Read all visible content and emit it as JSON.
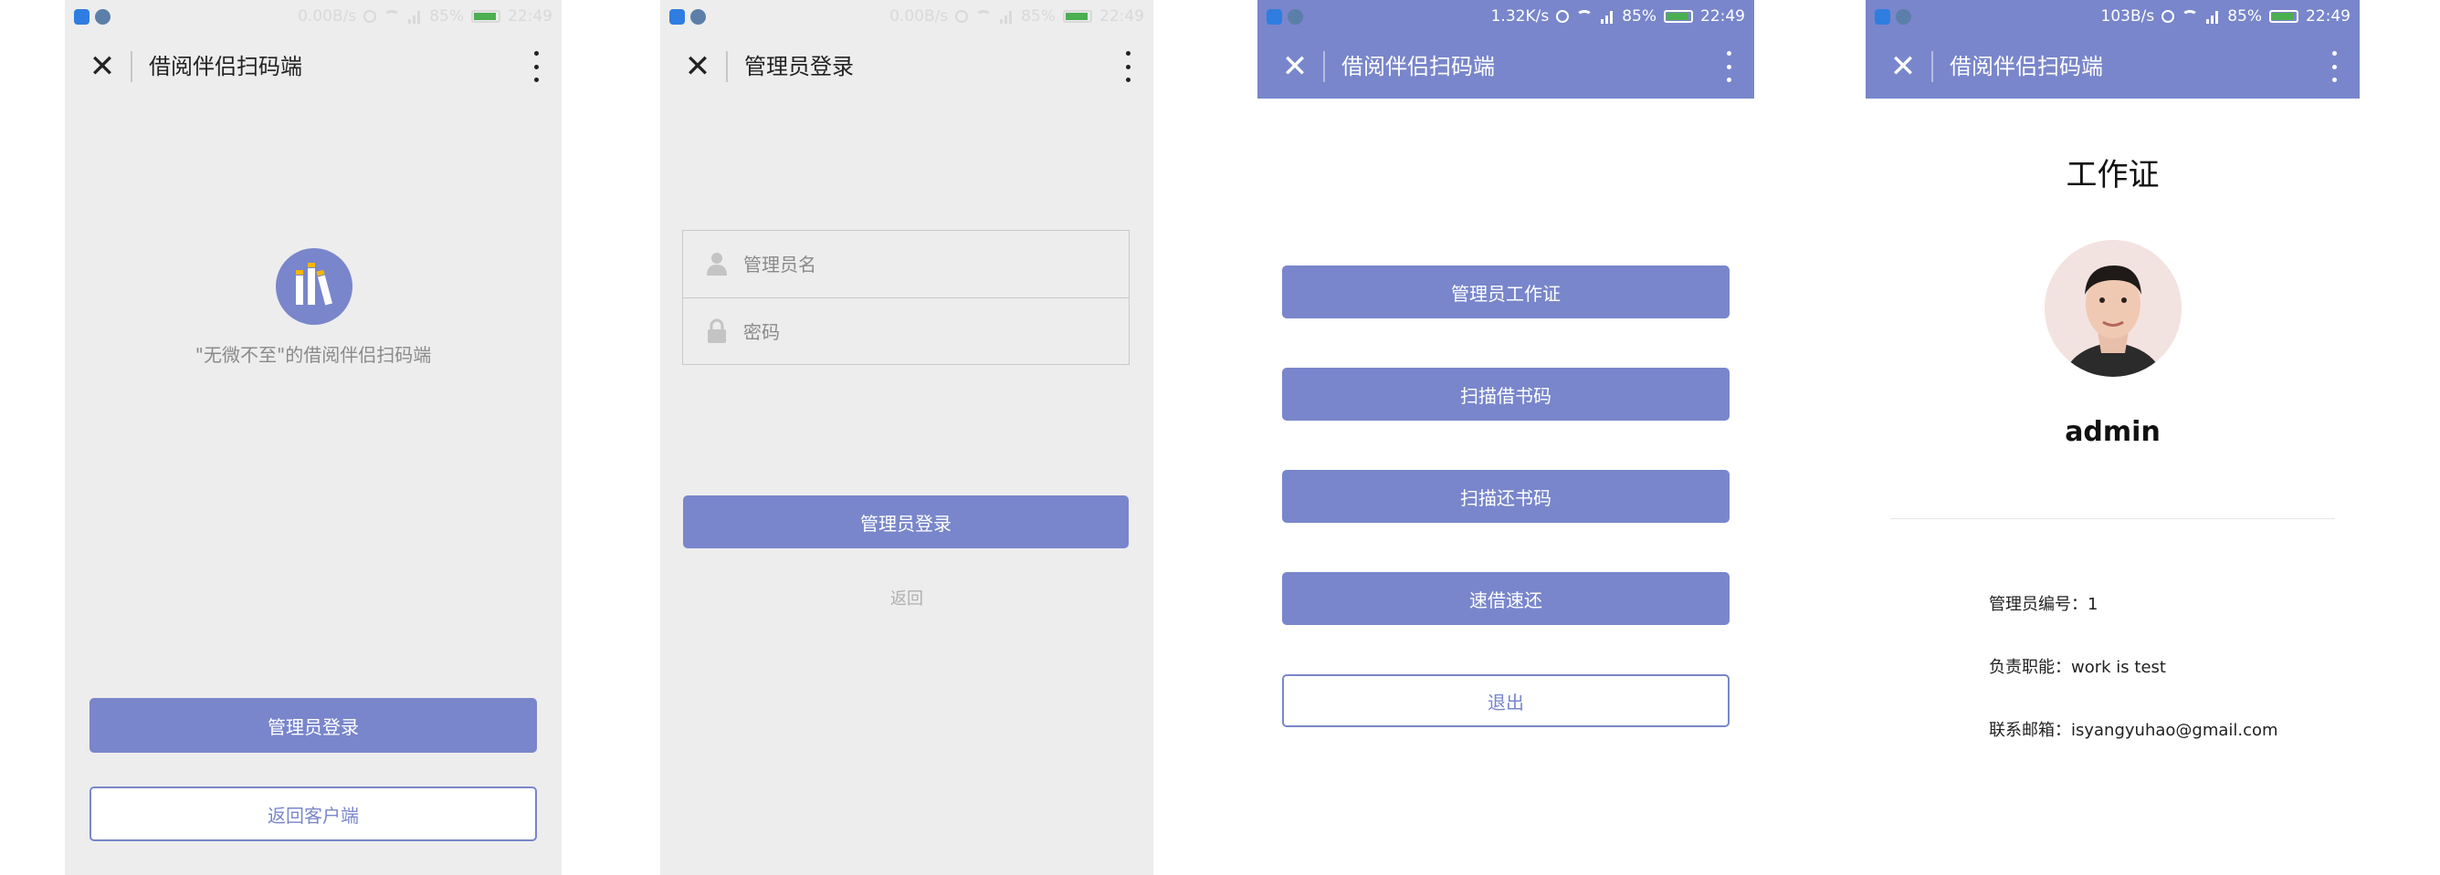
{
  "statusbar": {
    "s1": {
      "speed": "0.00B/s",
      "battery": "85%",
      "time": "22:49"
    },
    "s2": {
      "speed": "0.00B/s",
      "battery": "85%",
      "time": "22:49"
    },
    "s3": {
      "speed": "1.32K/s",
      "battery": "85%",
      "time": "22:49"
    },
    "s4": {
      "speed": "103B/s",
      "battery": "85%",
      "time": "22:49"
    }
  },
  "screen1": {
    "title": "借阅伴侣扫码端",
    "tagline": "\"无微不至\"的借阅伴侣扫码端",
    "admin_login": "管理员登录",
    "back_to_client": "返回客户端"
  },
  "screen2": {
    "title": "管理员登录",
    "username_placeholder": "管理员名",
    "password_placeholder": "密码",
    "login_button": "管理员登录",
    "back_link": "返回"
  },
  "screen3": {
    "title": "借阅伴侣扫码端",
    "buttons": [
      "管理员工作证",
      "扫描借书码",
      "扫描还书码",
      "速借速还"
    ],
    "logout": "退出"
  },
  "screen4": {
    "title": "借阅伴侣扫码端",
    "card_title": "工作证",
    "username": "admin",
    "admin_id_label": "管理员编号：",
    "admin_id": "1",
    "duty_label": "负责职能：",
    "duty": "work is test",
    "email_label": "联系邮箱：",
    "email": "isyangyuhao@gmail.com"
  },
  "colors": {
    "accent": "#7986cb",
    "background": "#ededed"
  },
  "icons": {
    "close": "close-icon",
    "more": "more-vertical-icon",
    "user": "user-icon",
    "lock": "lock-icon",
    "logo": "books-logo-icon"
  }
}
